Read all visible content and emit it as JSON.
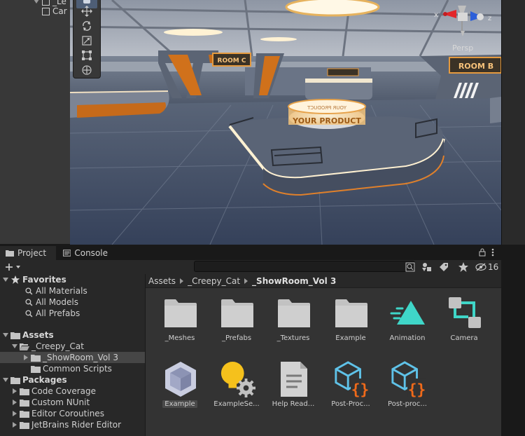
{
  "hierarchy": {
    "items": [
      {
        "label": "_Le"
      },
      {
        "label": "Car"
      }
    ]
  },
  "scene": {
    "signs": {
      "room_c": "ROOM C",
      "room_b": "ROOM B",
      "product_front": "YOUR PRODUCT",
      "product_back": "YOUR PRODUCT"
    },
    "gizmo": {
      "x_label": "x",
      "z_label": "z",
      "projection": "Persp"
    }
  },
  "project": {
    "tabs": [
      {
        "label": "Project",
        "icon": "folder-icon"
      },
      {
        "label": "Console",
        "icon": "console-icon"
      }
    ],
    "search": {
      "value": "",
      "placeholder": ""
    },
    "hidden_count": "16",
    "tree": {
      "favorites_label": "Favorites",
      "favorites": [
        {
          "label": "All Materials"
        },
        {
          "label": "All Models"
        },
        {
          "label": "All Prefabs"
        }
      ],
      "assets_label": "Assets",
      "creepy_cat": "_Creepy_Cat",
      "showroom": "_ShowRoom_Vol 3",
      "common_scripts": "Common Scripts",
      "packages_label": "Packages",
      "packages": [
        {
          "label": "Code Coverage"
        },
        {
          "label": "Custom NUnit"
        },
        {
          "label": "Editor Coroutines"
        },
        {
          "label": "JetBrains Rider Editor"
        }
      ]
    },
    "breadcrumb": [
      "Assets",
      "_Creepy_Cat",
      "_ShowRoom_Vol 3"
    ],
    "assets": [
      {
        "label": "_Meshes",
        "type": "folder"
      },
      {
        "label": "_Prefabs",
        "type": "folder"
      },
      {
        "label": "_Textures",
        "type": "folder"
      },
      {
        "label": "Example",
        "type": "folder"
      },
      {
        "label": "Animation",
        "type": "folder-animation"
      },
      {
        "label": "Camera",
        "type": "folder-camera"
      },
      {
        "label": "Example",
        "type": "scene"
      },
      {
        "label": "ExampleSe...",
        "type": "lighting-settings"
      },
      {
        "label": "Help Read...",
        "type": "text-document"
      },
      {
        "label": "Post-Proc...",
        "type": "script-asset"
      },
      {
        "label": "Post-proc...",
        "type": "script-asset"
      }
    ]
  },
  "colors": {
    "accent_orange": "#e87a1e",
    "animation_teal": "#3fd6c8",
    "script_blue": "#5fc2e8",
    "script_orange": "#f06a1a",
    "light_yellow": "#f5c11c"
  }
}
